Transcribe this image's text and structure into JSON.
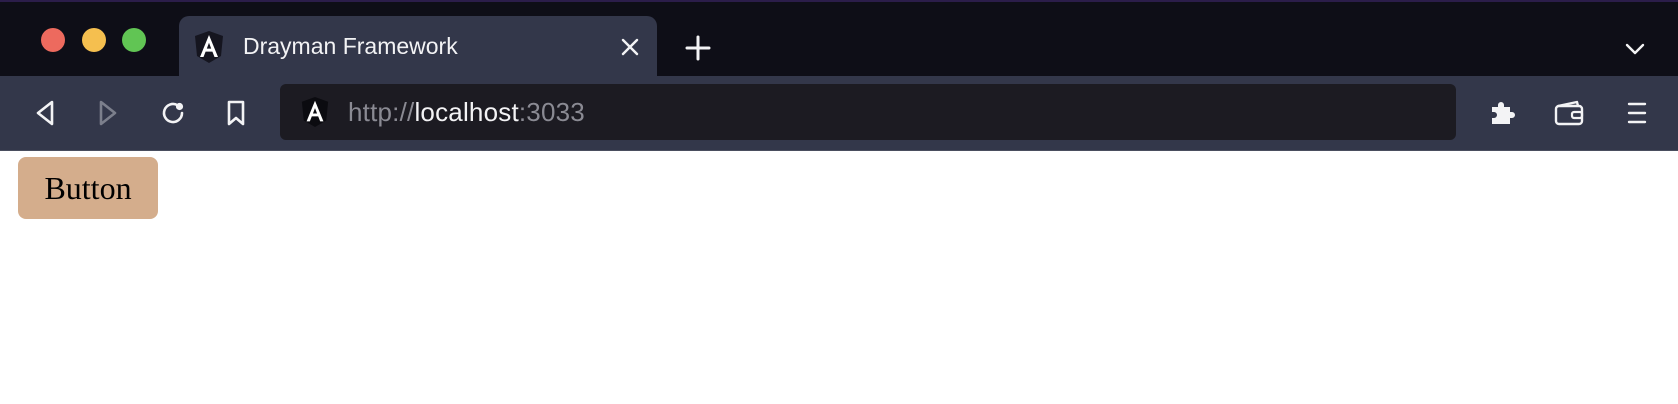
{
  "window": {
    "traffic_lights": {
      "close_color": "#ed6a5e",
      "minimize_color": "#f5bf4f",
      "zoom_color": "#61c554"
    }
  },
  "tab": {
    "title": "Drayman Framework",
    "favicon": "angular-logo-icon",
    "close_icon": "close-icon"
  },
  "tabstrip": {
    "new_tab_icon": "plus-icon",
    "list_all_tabs_icon": "chevron-down-icon"
  },
  "toolbar": {
    "back_icon": "back-arrow-icon",
    "forward_icon": "forward-arrow-icon",
    "reload_icon": "reload-icon",
    "bookmark_icon": "bookmark-icon",
    "extensions_icon": "puzzle-piece-icon",
    "wallet_icon": "wallet-icon",
    "menu_icon": "hamburger-menu-icon"
  },
  "urlbar": {
    "scheme": "http://",
    "host": "localhost",
    "port": ":3033",
    "favicon": "angular-logo-icon"
  },
  "page": {
    "button_label": "Button",
    "button_color": "#d4ad8c"
  },
  "colors": {
    "tabstrip_bg": "#0e0e17",
    "toolbar_bg": "#33374a",
    "urlbar_bg": "#1c1b22"
  }
}
